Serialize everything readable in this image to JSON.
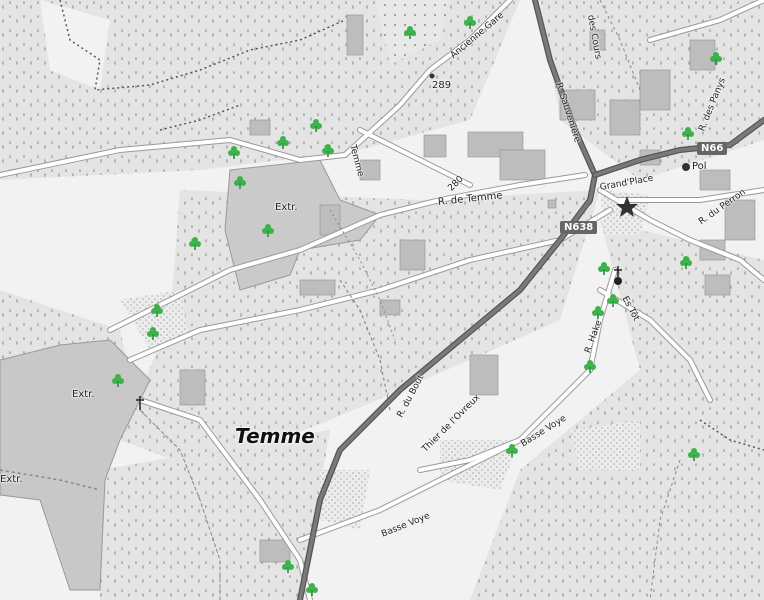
{
  "map": {
    "place_name": "Temme",
    "colors": {
      "background": "#f2f2f2",
      "forest": "#e2e2e2",
      "quarry": "#c9c9c9",
      "road": "#ffffff",
      "road_casing": "#9a9a9a",
      "main_road": "#6a6a6a",
      "building": "#bdbdbd",
      "tree_marker": "#3cb34a",
      "path": "#555555"
    },
    "labels": {
      "quarry_west": "Extr.",
      "quarry_mid": "Extr.",
      "quarry_edge": "Extr.",
      "street_temme_north": "Temme",
      "street_r_de_temme": "R. de Temme",
      "street_ancienne": "Ancienne Gare",
      "street_sauveniere": "R. Sauvenière",
      "street_des_cours": "des Cours",
      "street_des_panys": "R. des Panys",
      "street_grand_place": "Grand'Place",
      "street_perron": "R. du Perron",
      "street_hake": "R. Hake",
      "street_es_tot": "Es Tôt",
      "street_du_bout": "R. du Bout",
      "street_thier": "Thier de l'Ovreux",
      "street_basse_voye_1": "Basse Voye",
      "street_basse_voye_2": "Basse Voye",
      "poi_pol": "Pol",
      "elev_289": "289",
      "elev_280": "280"
    },
    "shields": {
      "n66": "N66",
      "n638": "N638"
    }
  }
}
